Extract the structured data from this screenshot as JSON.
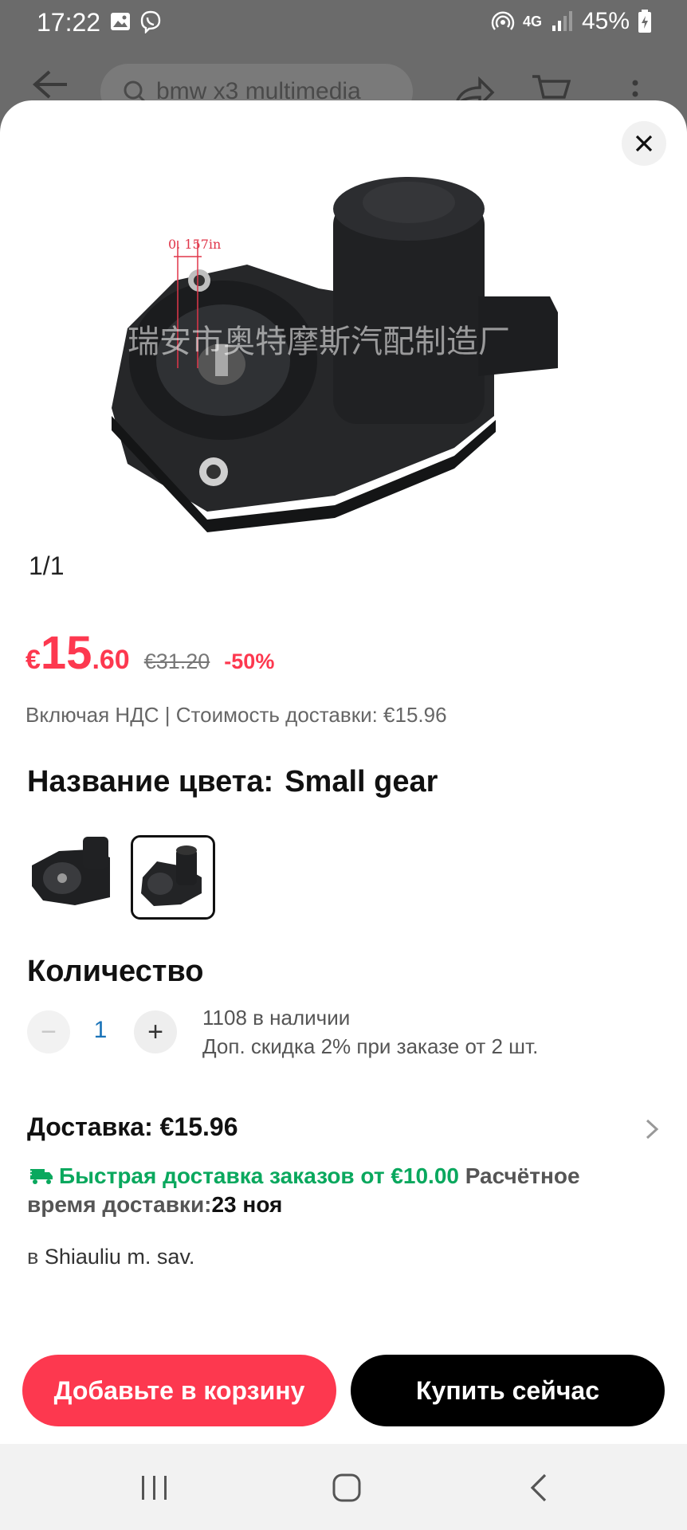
{
  "status_bar": {
    "time": "17:22",
    "battery": "45%",
    "network": "4G"
  },
  "background": {
    "search_placeholder": "bmw x3 multimedia"
  },
  "product": {
    "image_label": "0. 157in",
    "image_watermark": "瑞安市奥特摩斯汽配制造厂",
    "image_counter": "1/1"
  },
  "price": {
    "currency": "€",
    "integer": "15",
    "decimal": ".60",
    "old_price": "€31.20",
    "discount": "-50%",
    "vat_line": "Включая НДС | Стоимость доставки: €15.96"
  },
  "color": {
    "label": "Название цвета:",
    "value": "Small gear",
    "selected_index": 1
  },
  "quantity": {
    "title": "Количество",
    "minus": "−",
    "value": "1",
    "plus": "+",
    "stock": "1108 в наличии",
    "bulk_discount": "Доп. скидка 2% при заказе от 2 шт."
  },
  "delivery": {
    "title": "Доставка: €15.96",
    "fast_text": "Быстрая доставка заказов от €10.00",
    "estimate_label": "Расчётное время доставки:",
    "estimate_date": "23 ноя",
    "location_prefix": "в",
    "location": "Shiauliu m. sav."
  },
  "actions": {
    "add_to_cart": "Добавьте в корзину",
    "buy_now": "Купить сейчас"
  },
  "colors": {
    "accent": "#fd384f",
    "green": "#0aa85e",
    "qty_blue": "#1a73b8"
  }
}
